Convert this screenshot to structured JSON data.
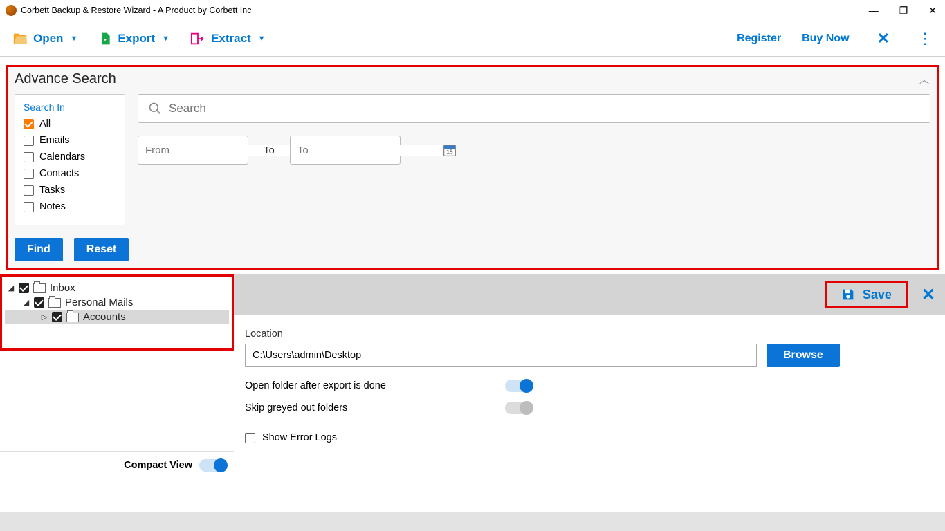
{
  "window": {
    "title": "Corbett Backup & Restore Wizard - A Product by Corbett Inc"
  },
  "toolbar": {
    "open": "Open",
    "export": "Export",
    "extract": "Extract",
    "register": "Register",
    "buy": "Buy Now"
  },
  "adv": {
    "title": "Advance Search",
    "search_in": "Search In",
    "options": {
      "all": "All",
      "emails": "Emails",
      "calendars": "Calendars",
      "contacts": "Contacts",
      "tasks": "Tasks",
      "notes": "Notes"
    },
    "search_placeholder": "Search",
    "from_placeholder": "From",
    "to_label": "To",
    "to_placeholder": "To",
    "find": "Find",
    "reset": "Reset"
  },
  "tree": {
    "inbox": "Inbox",
    "personal": "Personal Mails",
    "accounts": "Accounts",
    "compact": "Compact View"
  },
  "save": {
    "label": "Save"
  },
  "form": {
    "location_label": "Location",
    "location_value": "C:\\Users\\admin\\Desktop",
    "browse": "Browse",
    "open_folder": "Open folder after export is done",
    "skip_greyed": "Skip greyed out folders",
    "show_errors": "Show Error Logs"
  }
}
